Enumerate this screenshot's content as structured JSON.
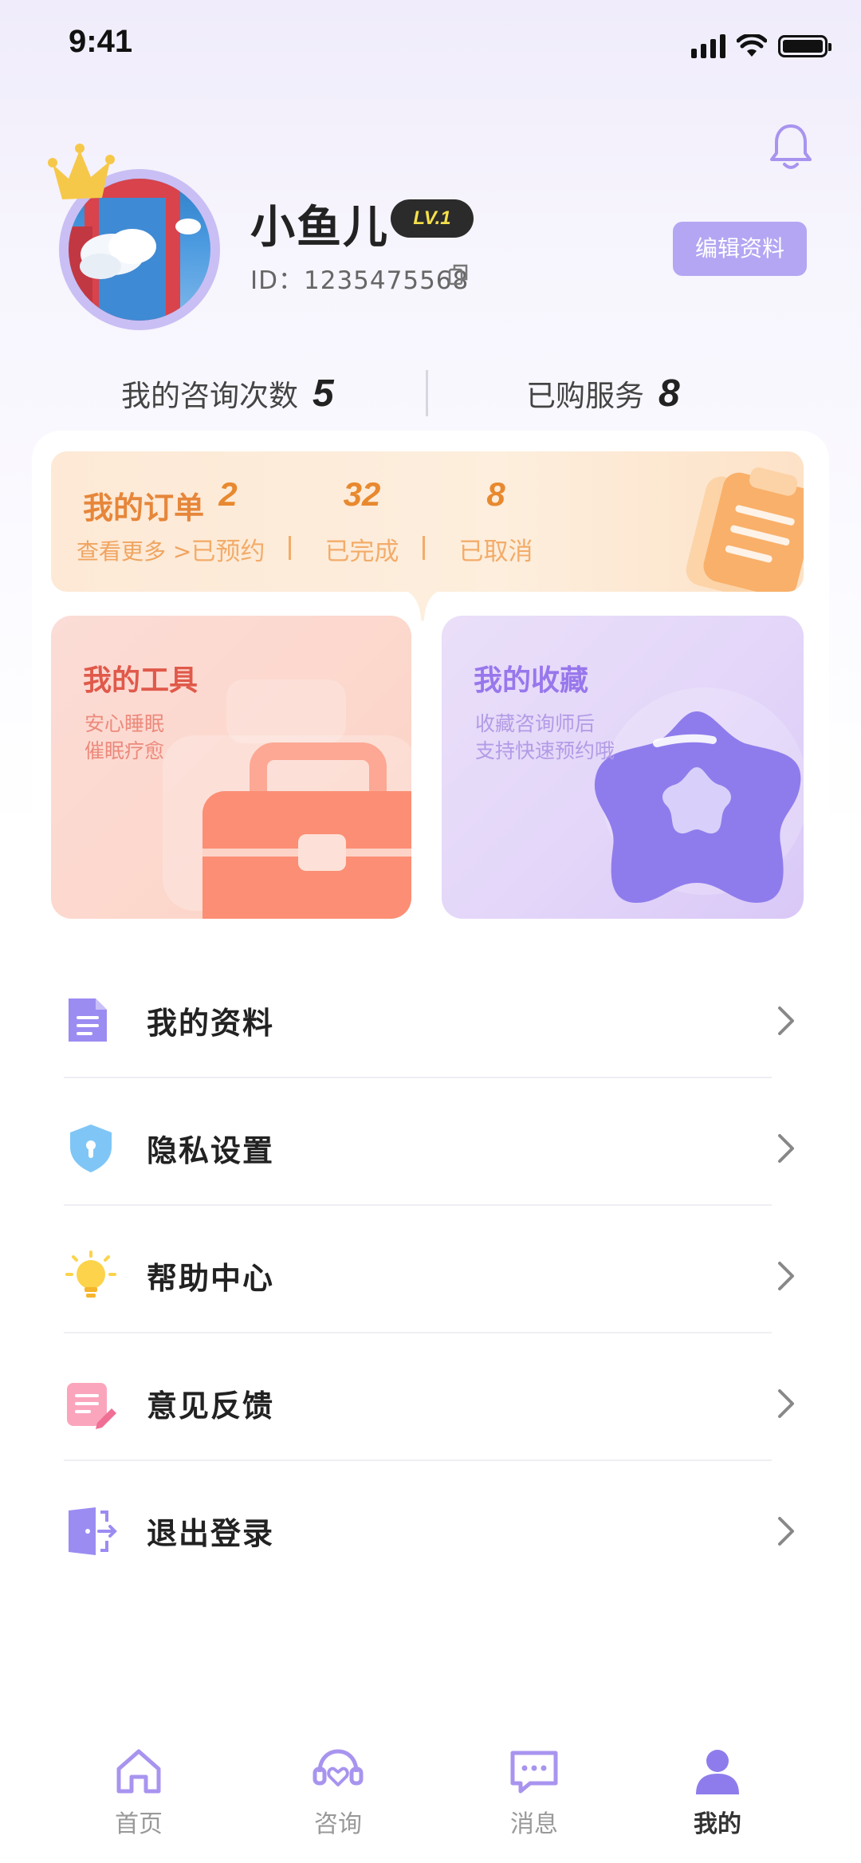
{
  "status_bar": {
    "time": "9:41"
  },
  "profile": {
    "nickname": "小鱼儿",
    "level": "LV.1",
    "id_text": "ID：1235475568",
    "edit_label": "编辑资料"
  },
  "stats": [
    {
      "label": "我的咨询次数",
      "value": "5"
    },
    {
      "label": "已购服务",
      "value": "8"
    }
  ],
  "orders": {
    "title": "我的订单",
    "more": "查看更多 >",
    "items": [
      {
        "count": "2",
        "label": "已预约"
      },
      {
        "count": "32",
        "label": "已完成"
      },
      {
        "count": "8",
        "label": "已取消"
      }
    ]
  },
  "cards": {
    "tools": {
      "title": "我的工具",
      "line1": "安心睡眠",
      "line2": "催眠疗愈"
    },
    "favorites": {
      "title": "我的收藏",
      "line1": "收藏咨询师后",
      "line2": "支持快速预约哦"
    }
  },
  "menu": [
    {
      "label": "我的资料",
      "icon": "document-icon"
    },
    {
      "label": "隐私设置",
      "icon": "shield-icon"
    },
    {
      "label": "帮助中心",
      "icon": "lightbulb-icon"
    },
    {
      "label": "意见反馈",
      "icon": "feedback-icon"
    },
    {
      "label": "退出登录",
      "icon": "logout-icon"
    }
  ],
  "tabs": [
    {
      "label": "首页",
      "icon": "home-icon"
    },
    {
      "label": "咨询",
      "icon": "consult-icon"
    },
    {
      "label": "消息",
      "icon": "message-icon"
    },
    {
      "label": "我的",
      "icon": "user-icon",
      "active": true
    }
  ],
  "colors": {
    "accent": "#b4a6f3",
    "order_orange": "#e8892f",
    "tools_red": "#e0594a",
    "favorites_purple": "#9877ec",
    "level_badge_text": "#f5e04a"
  }
}
